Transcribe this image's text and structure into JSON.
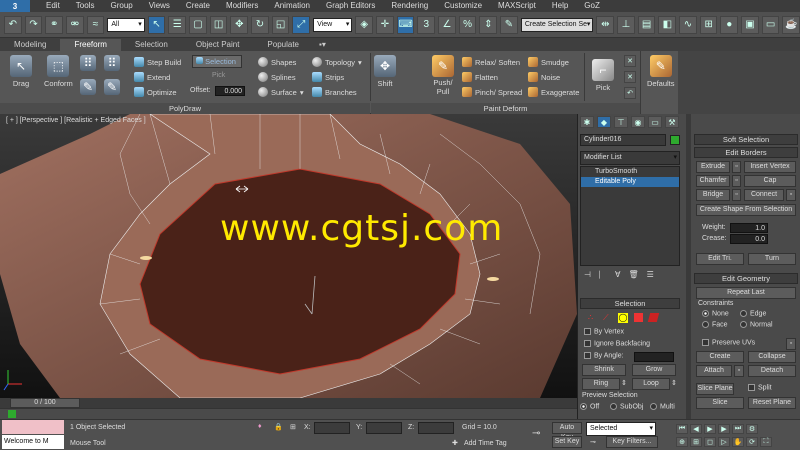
{
  "menu": {
    "items": [
      "Edit",
      "Tools",
      "Group",
      "Views",
      "Create",
      "Modifiers",
      "Animation",
      "Graph Editors",
      "Rendering",
      "Customize",
      "MAXScript",
      "Help",
      "GoZ"
    ]
  },
  "toolbar": {
    "filter_value": "All",
    "refcoord_value": "View",
    "named_selection_placeholder": "Create Selection Se"
  },
  "ribbon": {
    "tabs": [
      "Modeling",
      "Freeform",
      "Selection",
      "Object Paint",
      "Populate"
    ],
    "active_tab": "Freeform",
    "polydraw": {
      "label": "PolyDraw",
      "drag": "Drag",
      "conform": "Conform",
      "step_build": "Step Build",
      "extend": "Extend",
      "optimize": "Optimize",
      "selection": "Selection",
      "pick": "Pick",
      "offset_label": "Offset:",
      "offset_value": "0.000",
      "shapes": "Shapes",
      "splines": "Splines",
      "surface": "Surface",
      "topology": "Topology",
      "strips": "Strips",
      "branches": "Branches"
    },
    "paint_deform": {
      "label": "Paint Deform",
      "shift": "Shift",
      "push_pull": "Push/\nPull",
      "relax_soften": "Relax/ Soften",
      "flatten": "Flatten",
      "pinch_spread": "Pinch/ Spread",
      "smudge": "Smudge",
      "noise": "Noise",
      "exaggerate": "Exaggerate",
      "pick": "Pick"
    },
    "defaults": "Defaults"
  },
  "viewport": {
    "label": "[ + ] [Perspective ] [Realistic + Edged Faces ]",
    "watermark": "www.cgtsj.com"
  },
  "command_panel": {
    "object_name": "Cylinder016",
    "modifier_list": "Modifier List",
    "stack": [
      "TurboSmooth",
      "Editable Poly"
    ],
    "selection": {
      "title": "Selection",
      "by_vertex": "By Vertex",
      "ignore_backfacing": "Ignore Backfacing",
      "by_angle": "By Angle:",
      "shrink": "Shrink",
      "grow": "Grow",
      "ring": "Ring",
      "loop": "Loop",
      "preview_selection": "Preview Selection",
      "off": "Off",
      "subobj": "SubObj",
      "multi": "Multi"
    },
    "soft_selection": "Soft Selection",
    "edit_borders": {
      "title": "Edit Borders",
      "extrude": "Extrude",
      "insert_vertex": "Insert Vertex",
      "chamfer": "Chamfer",
      "cap": "Cap",
      "bridge": "Bridge",
      "connect": "Connect",
      "create_shape": "Create Shape From Selection",
      "weight_label": "Weight:",
      "weight_value": "1.0",
      "crease_label": "Crease:",
      "crease_value": "0.0",
      "edit_tri": "Edit Tri.",
      "turn": "Turn"
    },
    "edit_geometry": {
      "title": "Edit Geometry",
      "repeat_last": "Repeat Last",
      "constraints": "Constraints",
      "none": "None",
      "edge": "Edge",
      "face": "Face",
      "normal": "Normal",
      "preserve_uvs": "Preserve UVs",
      "create": "Create",
      "collapse": "Collapse",
      "attach": "Attach",
      "detach": "Detach",
      "slice_plane": "Slice Plane",
      "split": "Split",
      "slice": "Slice",
      "reset_plane": "Reset Plane"
    }
  },
  "timeline": {
    "frame": "0 / 100"
  },
  "status": {
    "maxscript": "Welcome to M",
    "selected": "1 Object Selected",
    "prompt": "Mouse Tool",
    "x_label": "X:",
    "y_label": "Y:",
    "z_label": "Z:",
    "grid": "Grid = 10.0",
    "add_time_tag": "Add Time Tag",
    "auto_key": "Auto Key",
    "set_key": "Set Key",
    "selected_dd": "Selected",
    "key_filters": "Key Filters..."
  }
}
